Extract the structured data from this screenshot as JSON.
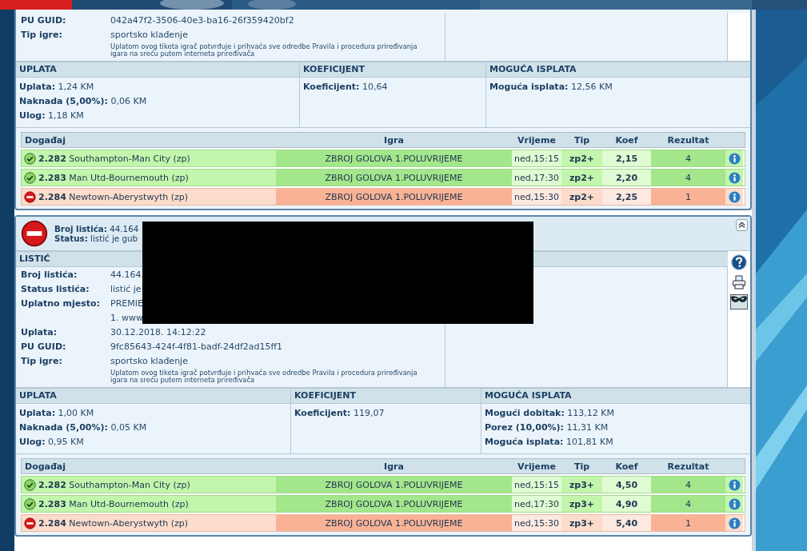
{
  "tickets": [
    {
      "redacted": false,
      "info_rows": [
        {
          "label": "PU GUID:",
          "value": "042a47f2-3506-40e3-ba16-26f359420bf2"
        },
        {
          "label": "Tip igre:",
          "value": "sportsko klađenje"
        }
      ],
      "disclaimer": "Uplatom ovog tiketa igrač potvrđuje i prihvaća sve odredbe Pravila i procedura priređivanja igara na sreću putem interneta priređivača",
      "side_icons": false,
      "money": [
        {
          "title": "UPLATA",
          "lines": [
            {
              "label": "Uplata:",
              "value": "1,24 KM"
            },
            {
              "label": "Naknada (5,00%):",
              "value": "0,06 KM"
            },
            {
              "label": "Ulog:",
              "value": "1,18 KM"
            }
          ]
        },
        {
          "title": "KOEFICIJENT",
          "lines": [
            {
              "label": "Koeficijent:",
              "value": "10,64"
            }
          ]
        },
        {
          "title": "MOGUĆA ISPLATA",
          "lines": [
            {
              "label": "Moguća isplata:",
              "value": "12,56 KM"
            }
          ]
        }
      ],
      "columns": [
        "Događaj",
        "Igra",
        "Vrijeme",
        "Tip",
        "Koef",
        "Rezultat"
      ],
      "events": [
        {
          "won": true,
          "code": "2.282",
          "match": "Southampton-Man City (zp)",
          "game": "ZBROJ GOLOVA 1.POLUVRIJEME",
          "time": "ned,15:15",
          "tip": "zp2+",
          "odds": "2,15",
          "result": "4"
        },
        {
          "won": true,
          "code": "2.283",
          "match": "Man Utd-Bournemouth (zp)",
          "game": "ZBROJ GOLOVA 1.POLUVRIJEME",
          "time": "ned,17:30",
          "tip": "zp2+",
          "odds": "2,20",
          "result": "4"
        },
        {
          "won": false,
          "code": "2.284",
          "match": "Newtown-Aberystwyth (zp)",
          "game": "ZBROJ GOLOVA 1.POLUVRIJEME",
          "time": "ned,15:30",
          "tip": "zp2+",
          "odds": "2,25",
          "result": "1"
        }
      ]
    },
    {
      "header": {
        "won": false,
        "lines": [
          {
            "label": "Broj listića:",
            "value": "44.164"
          },
          {
            "label": "Status:",
            "value": "listić je gub"
          }
        ]
      },
      "redacted": true,
      "section_title": "LISTIĆ",
      "info_rows": [
        {
          "label": "Broj listića:",
          "value": "44.164."
        },
        {
          "label": "Status listića:",
          "value": "listić je"
        },
        {
          "label": "Uplatno mjesto:",
          "value": "PREMIE"
        },
        {
          "label": "",
          "value": "1. www"
        },
        {
          "label": "Uplata:",
          "value": "30.12.2018. 14:12:22"
        },
        {
          "label": "PU GUID:",
          "value": "9fc85643-424f-4f81-badf-24df2ad15ff1"
        },
        {
          "label": "Tip igre:",
          "value": "sportsko klađenje"
        }
      ],
      "disclaimer": "Uplatom ovog tiketa igrač potvrđuje i prihvaća sve odredbe Pravila i procedura priređivanja igara na sreću putem interneta priređivača",
      "side_icons": true,
      "money": [
        {
          "title": "UPLATA",
          "lines": [
            {
              "label": "Uplata:",
              "value": "1,00 KM"
            },
            {
              "label": "Naknada (5,00%):",
              "value": "0,05 KM"
            },
            {
              "label": "Ulog:",
              "value": "0,95 KM"
            }
          ]
        },
        {
          "title": "KOEFICIJENT",
          "lines": [
            {
              "label": "Koeficijent:",
              "value": "119,07"
            }
          ]
        },
        {
          "title": "MOGUĆA ISPLATA",
          "lines": [
            {
              "label": "Mogući dobitak:",
              "value": "113,12 KM"
            },
            {
              "label": "Porez (10,00%):",
              "value": "11,31 KM"
            },
            {
              "label": "Moguća isplata:",
              "value": "101,81 KM"
            }
          ]
        }
      ],
      "columns": [
        "Događaj",
        "Igra",
        "Vrijeme",
        "Tip",
        "Koef",
        "Rezultat"
      ],
      "events": [
        {
          "won": true,
          "code": "2.282",
          "match": "Southampton-Man City (zp)",
          "game": "ZBROJ GOLOVA 1.POLUVRIJEME",
          "time": "ned,15:15",
          "tip": "zp3+",
          "odds": "4,50",
          "result": "4"
        },
        {
          "won": true,
          "code": "2.283",
          "match": "Man Utd-Bournemouth (zp)",
          "game": "ZBROJ GOLOVA 1.POLUVRIJEME",
          "time": "ned,17:30",
          "tip": "zp3+",
          "odds": "4,90",
          "result": "4"
        },
        {
          "won": false,
          "code": "2.284",
          "match": "Newtown-Aberystwyth (zp)",
          "game": "ZBROJ GOLOVA 1.POLUVRIJEME",
          "time": "ned,15:30",
          "tip": "zp3+",
          "odds": "5,40",
          "result": "1"
        }
      ]
    }
  ]
}
